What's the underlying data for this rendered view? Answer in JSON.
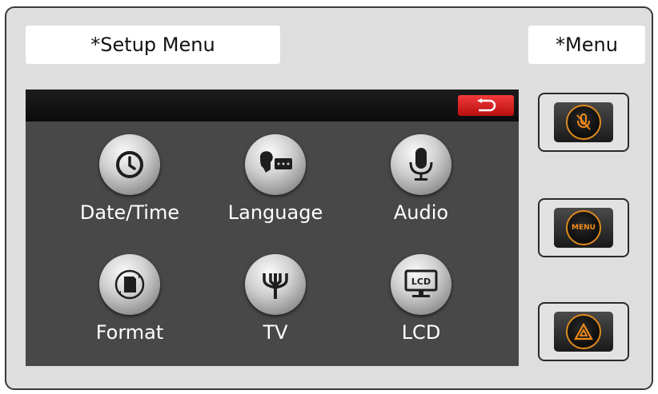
{
  "header": {
    "setup_menu_label": "*Setup Menu",
    "menu_label": "*Menu"
  },
  "screen": {
    "back_icon": "return-icon",
    "apps": [
      {
        "label": "Date/Time",
        "icon": "clock-icon"
      },
      {
        "label": "Language",
        "icon": "speech-icon"
      },
      {
        "label": "Audio",
        "icon": "microphone-icon"
      },
      {
        "label": "Format",
        "icon": "sd-card-icon"
      },
      {
        "label": "TV",
        "icon": "antenna-icon"
      },
      {
        "label": "LCD",
        "icon": "lcd-icon"
      }
    ],
    "lcd_icon_text": "LCD"
  },
  "side_buttons": [
    {
      "icon": "voice-mute-icon"
    },
    {
      "icon": "menu-icon",
      "text": "MENU"
    },
    {
      "icon": "hazard-icon"
    }
  ],
  "colors": {
    "accent_orange": "#f08a1a",
    "back_red": "#e02020",
    "screen_bg": "#484848"
  }
}
